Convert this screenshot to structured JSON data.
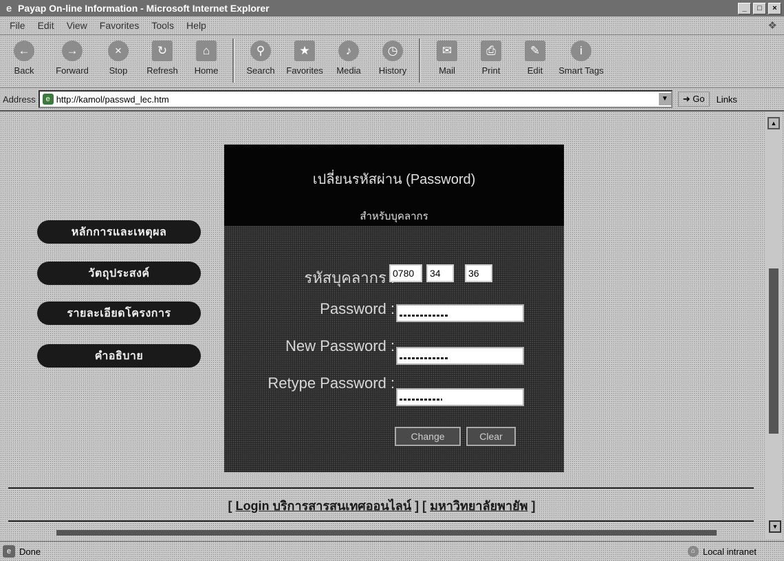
{
  "window": {
    "title": "Payap On-line Information - Microsoft Internet Explorer",
    "controls": [
      "_",
      "□",
      "×"
    ]
  },
  "menu": [
    "File",
    "Edit",
    "View",
    "Favorites",
    "Tools",
    "Help"
  ],
  "toolbar": {
    "back": "Back",
    "forward": "Forward",
    "stop": "Stop",
    "refresh": "Refresh",
    "home": "Home",
    "search": "Search",
    "favorites": "Favorites",
    "media": "Media",
    "history": "History",
    "mail": "Mail",
    "print": "Print",
    "edit": "Edit",
    "smarttags": "Smart Tags"
  },
  "address": {
    "label": "Address",
    "url": "http://kamol/passwd_lec.htm",
    "go": "Go",
    "links": "Links"
  },
  "nav": {
    "principles": "หลักการและเหตุผล",
    "objectives": "วัตถุประสงค์",
    "details": "รายละเอียดโครงการ",
    "glossary": "คำอธิบาย"
  },
  "panel": {
    "title": "เปลี่ยนรหัสผ่าน (Password)",
    "subtitle": "สำหรับบุคลากร",
    "staff_id_label": "รหัสบุคลากร :",
    "staff_id": [
      "0780",
      "34",
      "36"
    ],
    "password_label": "Password :",
    "new_password_label": "New Password :",
    "retype_password_label": "Retype Password :",
    "change_button": "Change",
    "clear_button": "Clear"
  },
  "footer": {
    "open": "[",
    "login_link": "Login บริการสารสนเทศออนไลน์",
    "mid": "] [",
    "university_link": "มหาวิทยาลัยพายัพ",
    "close": "]"
  },
  "status": {
    "text": "Done",
    "zone": "Local intranet"
  }
}
